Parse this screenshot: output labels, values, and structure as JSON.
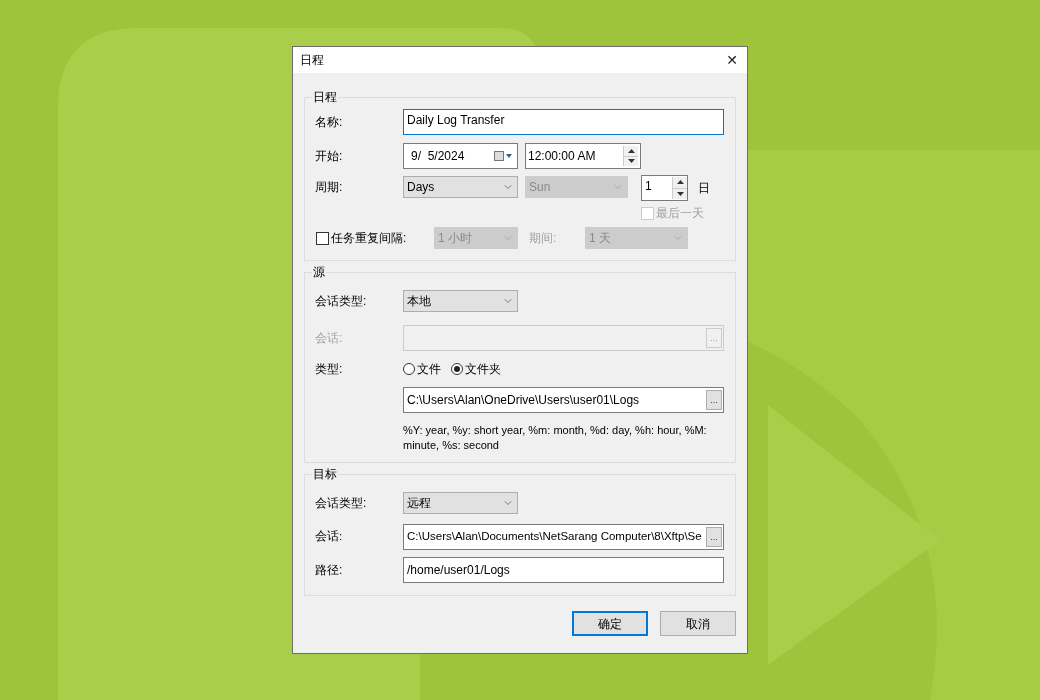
{
  "window": {
    "title": "日程",
    "close": "✕"
  },
  "schedule": {
    "title": "日程",
    "name": {
      "label": "名称:",
      "value": "Daily Log Transfer"
    },
    "start": {
      "label": "开始:",
      "date": "9/  5/2024",
      "time": "12:00:00 AM"
    },
    "period": {
      "label": "周期:",
      "unit": {
        "value": "Days",
        "disabled": false
      },
      "weekday": {
        "value": "Sun",
        "disabled": true
      },
      "count": "1",
      "count_unit": "日",
      "last_day": {
        "label": "最后一天",
        "checked": false,
        "disabled": true
      }
    },
    "repeat": {
      "label": "任务重复间隔:",
      "checked": false,
      "interval": {
        "value": "1 小时",
        "disabled": true
      },
      "duration_label": "期间:",
      "duration": {
        "value": "1 天",
        "disabled": true
      }
    }
  },
  "source": {
    "title": "源",
    "session_type": {
      "label": "会话类型:",
      "value": "本地",
      "disabled": false
    },
    "session": {
      "label": "会话:",
      "disabled": true,
      "browse": "..."
    },
    "type": {
      "label": "类型:",
      "options": [
        {
          "label": "文件",
          "selected": false
        },
        {
          "label": "文件夹",
          "selected": true
        }
      ]
    },
    "path": {
      "value": "C:\\Users\\Alan\\OneDrive\\Users\\user01\\Logs",
      "browse": "..."
    },
    "hint": "%Y: year, %y: short year, %m: month, %d: day, %h: hour, %M: minute, %s: second"
  },
  "target": {
    "title": "目标",
    "session_type": {
      "label": "会话类型:",
      "value": "远程",
      "disabled": false
    },
    "session": {
      "label": "会话:",
      "value": "C:\\Users\\Alan\\Documents\\NetSarang Computer\\8\\Xftp\\Se",
      "disabled": false,
      "browse": "..."
    },
    "path": {
      "label": "路径:",
      "value": "/home/user01/Logs"
    }
  },
  "buttons": [
    {
      "label": "确定",
      "default": true
    },
    {
      "label": "取消",
      "default": false
    }
  ]
}
